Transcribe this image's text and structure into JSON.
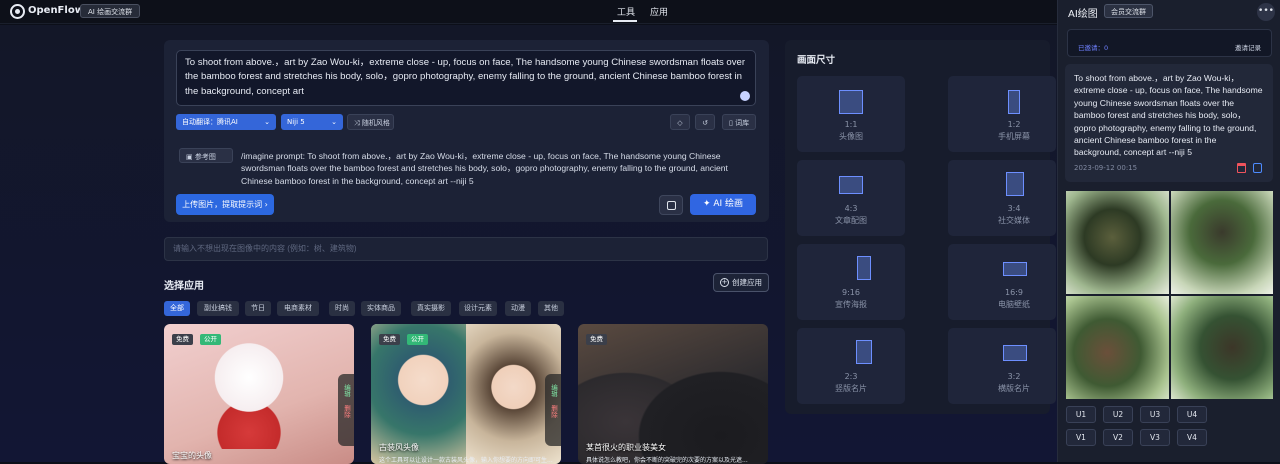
{
  "topbar": {
    "brand": "OpenFlow",
    "tag": "AI 绘画交流群",
    "nav": [
      "工具",
      "应用"
    ]
  },
  "prompt": {
    "text": "To shoot from above.，art by Zao Wou-ki，extreme close - up, focus on face, The handsome young Chinese swordsman floats over the bamboo forest and stretches his body, solo，gopro photography, enemy falling to the ground, ancient Chinese bamboo forest in the background, concept art",
    "translate_label": "自动翻译：腾讯AI",
    "model_label": "Niji 5",
    "random_label": "随机风格",
    "lexicon_label": "词库",
    "ref_label": "参考图",
    "imagine_text": "/imagine prompt:  To shoot from above.，art by Zao Wou-ki，extreme close - up, focus on face, The handsome young Chinese swordsman floats over the bamboo forest and stretches his body, solo，gopro photography, enemy falling to the ground, ancient Chinese bamboo forest in the background, concept art --niji 5",
    "upload_label": "上传图片，提取提示词",
    "draw_label": "AI 绘画",
    "negative_placeholder": "请输入不想出现在图像中的内容 (例如：树、建筑物)"
  },
  "apps": {
    "title": "选择应用",
    "create_label": "创建应用",
    "categories": [
      "全部",
      "副业搞钱",
      "节日",
      "电商素材",
      "时尚",
      "实体商品",
      "真实摄影",
      "设计元素",
      "动漫",
      "其他"
    ],
    "cards": [
      {
        "title": "宝宝的头像",
        "badges": [
          "免费",
          "公开"
        ],
        "side": [
          "编辑",
          "删除"
        ]
      },
      {
        "title": "古装风头像",
        "subtitle": "这个工具可以让设计一款古装风头像，输入你想要的方向即可生...",
        "badges": [
          "免费",
          "公开"
        ],
        "side": [
          "编辑",
          "删除"
        ]
      },
      {
        "title": "某首很火的职业装美女",
        "subtitle": "具体说怎么教吧，你会不断的突破完的次要的方案以及光遮...",
        "badges": [
          "免费"
        ]
      }
    ]
  },
  "sizes": {
    "title": "画面尺寸",
    "options": [
      {
        "ratio": "1:1",
        "label": "头像图"
      },
      {
        "ratio": "1:2",
        "label": "手机屏幕"
      },
      {
        "ratio": "4:3",
        "label": "文章配图"
      },
      {
        "ratio": "3:4",
        "label": "社交媒体"
      },
      {
        "ratio": "9:16",
        "label": "宣传海报"
      },
      {
        "ratio": "16:9",
        "label": "电脑壁纸"
      },
      {
        "ratio": "2:3",
        "label": "竖版名片"
      },
      {
        "ratio": "3:2",
        "label": "横版名片"
      }
    ]
  },
  "panel": {
    "title": "AI绘图",
    "tag": "会员交流群",
    "more": "•••",
    "invited": "已邀请：0",
    "invite_link": "邀请记录",
    "history_text": "To shoot from above.，art by Zao Wou-ki，extreme close - up, focus on face, The handsome young Chinese swordsman floats over the bamboo forest and stretches his body, solo，gopro photography, enemy falling to the ground, ancient Chinese bamboo forest in the background, concept art --niji 5",
    "history_time": "2023-09-12 00:15",
    "upscale": [
      "U1",
      "U2",
      "U3",
      "U4"
    ],
    "variation": [
      "V1",
      "V2",
      "V3",
      "V4"
    ]
  }
}
